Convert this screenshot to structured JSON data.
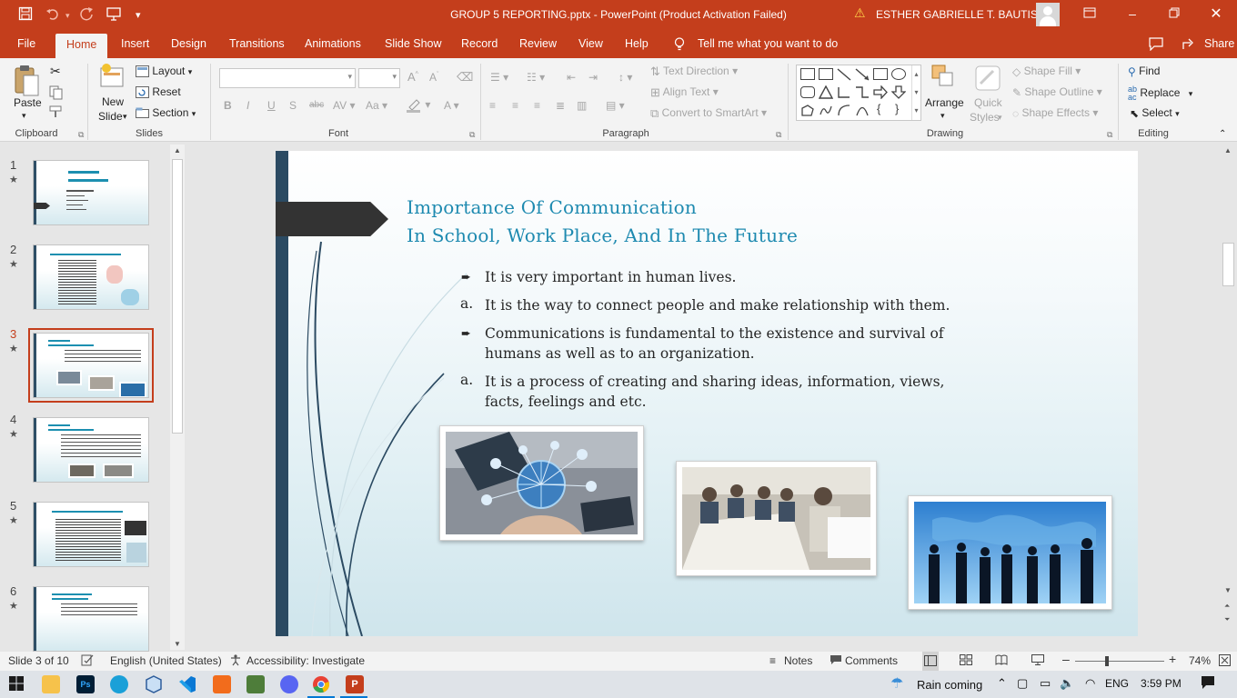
{
  "window": {
    "title": "GROUP 5 REPORTING.pptx  -  PowerPoint (Product Activation Failed)",
    "user": "ESTHER GABRIELLE T. BAUTISTA"
  },
  "tabs": [
    "File",
    "Home",
    "Insert",
    "Design",
    "Transitions",
    "Animations",
    "Slide Show",
    "Record",
    "Review",
    "View",
    "Help"
  ],
  "tell_me": "Tell me what you want to do",
  "comments_label": "",
  "share_label": "Share",
  "ribbon": {
    "clipboard": {
      "paste": "Paste",
      "label": "Clipboard"
    },
    "slides": {
      "new_slide_1": "New",
      "new_slide_2": "Slide",
      "layout": "Layout",
      "reset": "Reset",
      "section": "Section",
      "label": "Slides"
    },
    "font": {
      "label": "Font"
    },
    "paragraph": {
      "text_direction": "Text Direction",
      "align_text": "Align Text",
      "convert_smartart": "Convert to SmartArt",
      "label": "Paragraph"
    },
    "drawing": {
      "arrange": "Arrange",
      "quick_styles_1": "Quick",
      "quick_styles_2": "Styles",
      "shape_fill": "Shape Fill",
      "shape_outline": "Shape Outline",
      "shape_effects": "Shape Effects",
      "label": "Drawing"
    },
    "editing": {
      "find": "Find",
      "replace": "Replace",
      "select": "Select",
      "label": "Editing"
    }
  },
  "thumbnails": [
    {
      "num": "1",
      "star": "★"
    },
    {
      "num": "2",
      "star": "★"
    },
    {
      "num": "3",
      "star": "★"
    },
    {
      "num": "4",
      "star": "★"
    },
    {
      "num": "5",
      "star": "★"
    },
    {
      "num": "6",
      "star": "★"
    }
  ],
  "slide": {
    "title_line1": "Importance Of Communication",
    "title_line2": "In School, Work Place, And In The Future",
    "bullets": [
      {
        "marker": "arrow",
        "text": "It is very important in human lives."
      },
      {
        "marker": "a.",
        "text": "It is the way to connect people and make relationship with them."
      },
      {
        "marker": "arrow",
        "text_1": "Communications is fundamental to the existence and survival of",
        "text_2": "humans as well as to an organization."
      },
      {
        "marker": "a.",
        "text_1": "It is a process of creating and sharing ideas, information, views,",
        "text_2": "facts, feelings and etc."
      }
    ]
  },
  "status": {
    "slide_of": "Slide 3 of 10",
    "language": "English (United States)",
    "accessibility": "Accessibility: Investigate",
    "notes": "Notes",
    "comments": "Comments",
    "zoom": "74%"
  },
  "taskbar": {
    "weather": "Rain coming",
    "lang": "ENG",
    "time": "3:59 PM"
  },
  "colors": {
    "accent": "#c43e1c",
    "title_blue": "#1e8ab0",
    "slide_bar": "#2b4a62"
  }
}
